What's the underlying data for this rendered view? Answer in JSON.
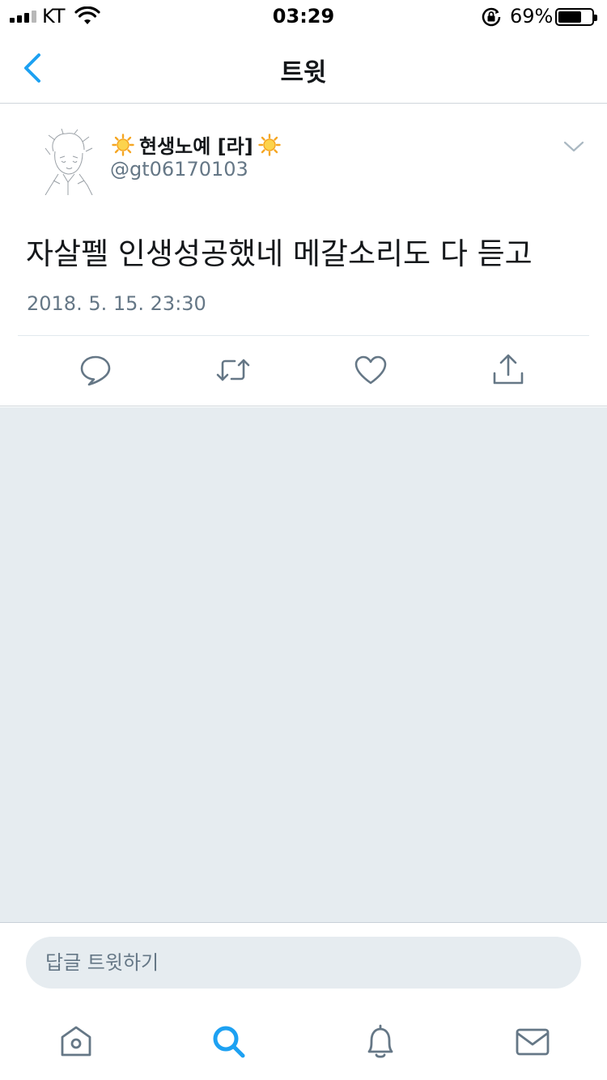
{
  "status_bar": {
    "carrier": "KT",
    "time": "03:29",
    "battery_percent": "69%",
    "battery_level": 0.69
  },
  "header": {
    "title": "트윗",
    "back_icon": "chevron-left-icon"
  },
  "tweet": {
    "author_name": "현생노예 [라]",
    "author_handle": "@gt06170103",
    "text": "자살펠 인생성공했네 메갈소리도 다 듣고",
    "timestamp": "2018. 5. 15. 23:30",
    "name_decoration_icon": "sun-emoji-icon",
    "actions": [
      "reply-icon",
      "retweet-icon",
      "like-icon",
      "share-icon"
    ]
  },
  "reply": {
    "placeholder": "답글 트윗하기"
  },
  "tab_bar": {
    "tabs": [
      "home-icon",
      "search-icon",
      "notifications-icon",
      "messages-icon"
    ],
    "active": "search-icon"
  },
  "colors": {
    "accent": "#1da1f2",
    "icon_gray": "#657786",
    "background_gray": "#e6ecf0",
    "text_primary": "#14171a"
  }
}
